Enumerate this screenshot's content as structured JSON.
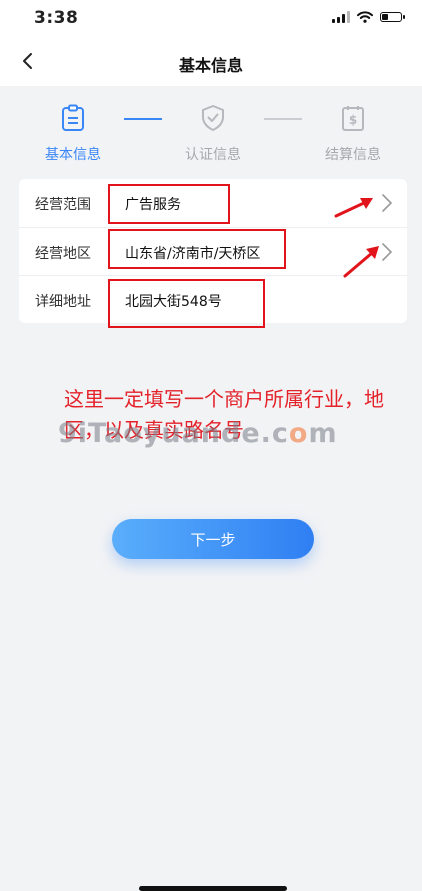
{
  "status_bar": {
    "time": "3:38"
  },
  "nav": {
    "title": "基本信息"
  },
  "steps": [
    {
      "label": "基本信息",
      "state": "active"
    },
    {
      "label": "认证信息",
      "state": "inactive"
    },
    {
      "label": "结算信息",
      "state": "inactive"
    }
  ],
  "form": {
    "rows": [
      {
        "label": "经营范围",
        "value": "广告服务",
        "has_arrow": true
      },
      {
        "label": "经营地区",
        "value": "山东省/济南市/天桥区",
        "has_arrow": true
      },
      {
        "label": "详细地址",
        "value": "北园大街548号",
        "has_arrow": false
      }
    ]
  },
  "annotation": {
    "note": "这里一定填写一个商户所属行业，地区，以及真实路名号",
    "watermark": {
      "prefix": "9iTaoyuande.c",
      "highlight": "o",
      "suffix": "m"
    }
  },
  "actions": {
    "next_label": "下一步"
  },
  "colors": {
    "accent": "#3a86f7",
    "annotation_red": "#e2141b",
    "inactive": "#a5a8ad",
    "background": "#f2f3f5"
  },
  "icons": {
    "back": "chevron-left-icon",
    "step1": "clipboard-icon",
    "step2": "shield-check-icon",
    "step3": "dollar-document-icon",
    "row_arrow": "chevron-right-icon"
  }
}
